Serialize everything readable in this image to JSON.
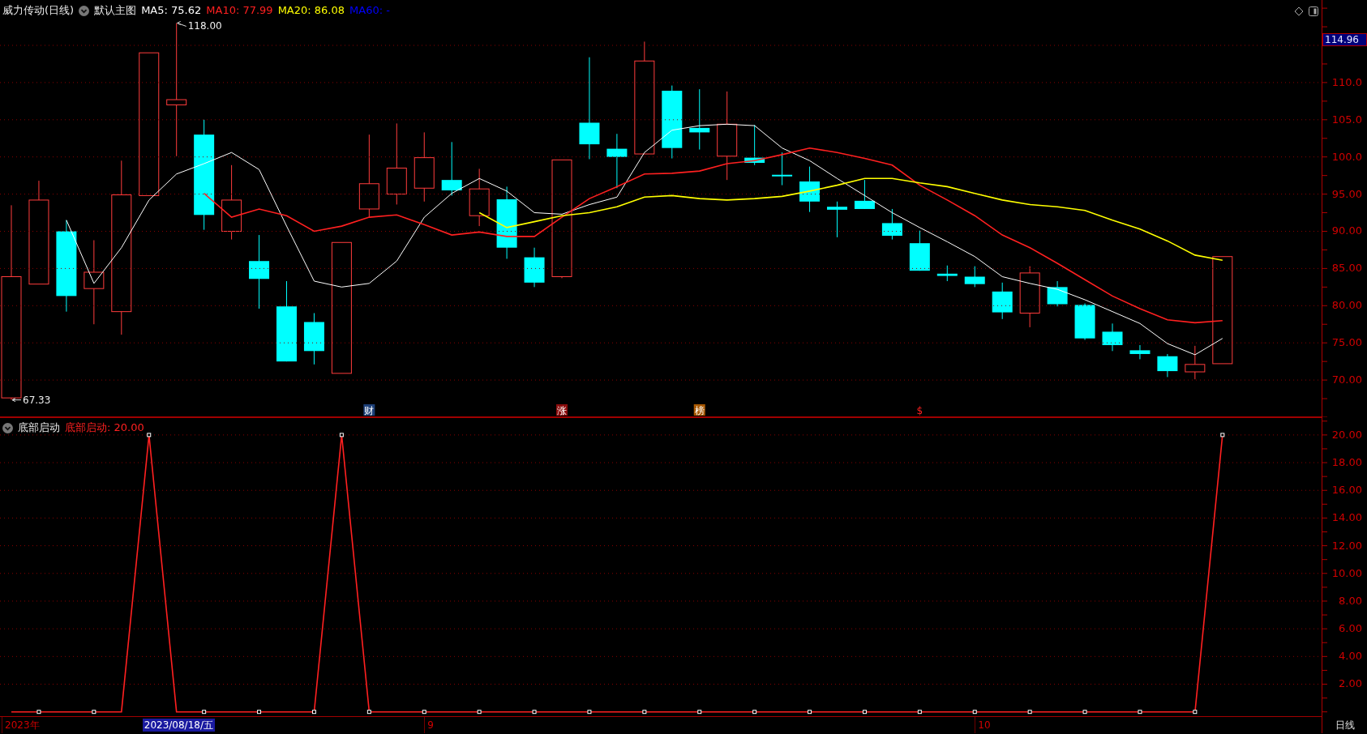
{
  "header": {
    "title": "威力传动(日线)",
    "template": "默认主图",
    "legend": [
      {
        "label": "MA5: 75.62",
        "color": "#ffffff"
      },
      {
        "label": "MA10: 77.99",
        "color": "#ff2020"
      },
      {
        "label": "MA20: 86.08",
        "color": "#ffff00"
      },
      {
        "label": "MA60: -",
        "color": "#0000ff"
      }
    ]
  },
  "price_label": "114.96",
  "main_chart": {
    "chart_data": {
      "type": "line",
      "ylim": [
        65,
        121.1
      ],
      "yticks": [
        {
          "value": 110,
          "label": "110.0"
        },
        {
          "value": 105,
          "label": "105.0"
        },
        {
          "value": 100,
          "label": "100.0"
        },
        {
          "value": 95,
          "label": "95.00"
        },
        {
          "value": 90,
          "label": "90.00"
        },
        {
          "value": 85,
          "label": "85.00"
        },
        {
          "value": 80,
          "label": "80.00"
        },
        {
          "value": 75,
          "label": "75.00"
        },
        {
          "value": 70,
          "label": "70.00"
        }
      ],
      "series": [
        {
          "color": "#ffffff",
          "values": [
            null,
            null,
            91.5,
            83.0,
            87.8,
            94.2,
            97.7,
            99.1,
            100.6,
            98.3,
            90.7,
            83.3,
            82.5,
            83.0,
            86.0,
            91.9,
            95.1,
            97.1,
            95.4,
            92.5,
            92.3,
            93.6,
            94.6,
            100.6,
            103.6,
            104.2,
            104.4,
            104.2,
            101.2,
            99.5,
            97.1,
            94.8,
            92.5,
            90.5,
            88.6,
            86.6,
            83.9,
            83.0,
            82.2,
            80.8,
            79.2,
            77.6,
            74.9,
            73.4,
            75.6
          ]
        },
        {
          "color": "#ff2020",
          "values": [
            null,
            null,
            null,
            null,
            null,
            null,
            null,
            95.1,
            91.9,
            93.0,
            92.1,
            90.0,
            90.7,
            91.9,
            92.2,
            90.9,
            89.5,
            89.9,
            89.3,
            89.3,
            91.9,
            94.4,
            96.0,
            97.7,
            97.8,
            98.1,
            99.1,
            99.5,
            100.3,
            101.2,
            100.6,
            99.8,
            98.9,
            96.2,
            94.2,
            92.1,
            89.5,
            87.8,
            85.7,
            83.5,
            81.3,
            79.6,
            78.1,
            77.7,
            78.0
          ]
        },
        {
          "color": "#ffff00",
          "values": [
            null,
            null,
            null,
            null,
            null,
            null,
            null,
            null,
            null,
            null,
            null,
            null,
            null,
            null,
            null,
            null,
            null,
            92.5,
            90.5,
            91.3,
            92.1,
            92.5,
            93.3,
            94.6,
            94.8,
            94.4,
            94.2,
            94.4,
            94.7,
            95.4,
            96.2,
            97.1,
            97.1,
            96.5,
            96.0,
            95.1,
            94.2,
            93.6,
            93.3,
            92.8,
            91.5,
            90.3,
            88.7,
            86.8,
            86.1
          ]
        }
      ],
      "annotations": [
        "118.00",
        "67.33"
      ],
      "grid": true
    },
    "event_markers": [
      {
        "kind": "badge",
        "text": "财",
        "color": "#1c3f78"
      },
      {
        "kind": "badge",
        "text": "涨",
        "color": "#8a0c0c"
      },
      {
        "kind": "badge",
        "text": "榜",
        "color": "#a85800"
      },
      {
        "kind": "mark",
        "text": "$",
        "color": "#ff2020"
      }
    ]
  },
  "lower_panel": {
    "title": "底部启动",
    "legend": [
      {
        "label": "底部启动: 20.00",
        "color": "#ff2020"
      }
    ],
    "chart_data": {
      "type": "line",
      "grid": true,
      "ylim": [
        -0.37,
        21.28
      ],
      "yticks": [
        {
          "value": 20,
          "label": "20.00"
        },
        {
          "value": 18,
          "label": "18.00"
        },
        {
          "value": 16,
          "label": "16.00"
        },
        {
          "value": 14,
          "label": "14.00"
        },
        {
          "value": 12,
          "label": "12.00"
        },
        {
          "value": 10,
          "label": "10.00"
        },
        {
          "value": 8,
          "label": "8.00"
        },
        {
          "value": 6,
          "label": "6.00"
        },
        {
          "value": 4,
          "label": "4.00"
        },
        {
          "value": 2,
          "label": "2.00"
        }
      ],
      "series": [
        {
          "color": "#ff2020",
          "values": [
            0,
            0,
            0,
            0,
            0,
            20,
            0,
            0,
            0,
            0,
            0,
            0,
            20,
            0,
            0,
            0,
            0,
            0,
            0,
            0,
            0,
            0,
            0,
            0,
            0,
            0,
            0,
            0,
            0,
            0,
            0,
            0,
            0,
            0,
            0,
            0,
            0,
            0,
            0,
            0,
            0,
            0,
            0,
            0,
            20
          ]
        }
      ]
    }
  },
  "time_axis": {
    "labels": [
      "2023年",
      "9",
      "10"
    ],
    "cursor_date": "2023/08/18/五",
    "period": "日线"
  }
}
